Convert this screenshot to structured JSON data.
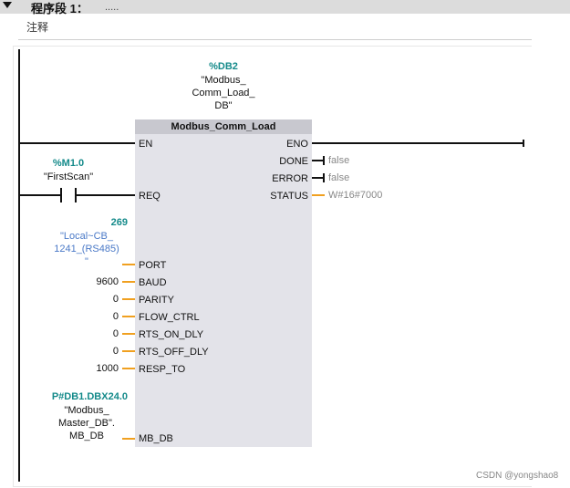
{
  "network": {
    "title": "程序段 1：",
    "description": ".....",
    "comment": "注释"
  },
  "block": {
    "instance_op": "%DB2",
    "instance_name": [
      "\"Modbus_",
      "Comm_Load_",
      "DB\""
    ],
    "title": "Modbus_Comm_Load",
    "input_pins": [
      "EN",
      "REQ",
      "PORT",
      "BAUD",
      "PARITY",
      "FLOW_CTRL",
      "RTS_ON_DLY",
      "RTS_OFF_DLY",
      "RESP_TO",
      "MB_DB"
    ],
    "output_pins": [
      "ENO",
      "DONE",
      "ERROR",
      "STATUS"
    ]
  },
  "req_contact": {
    "operand": "%M1.0",
    "symbol": "\"FirstScan\""
  },
  "port_param": {
    "value": "269",
    "symbol": [
      "\"Local~CB_",
      "1241_(RS485)",
      "\""
    ]
  },
  "params": {
    "baud": "9600",
    "parity": "0",
    "flow_ctrl": "0",
    "rts_on_dly": "0",
    "rts_off_dly": "0",
    "resp_to": "1000"
  },
  "mb_db_param": {
    "operand": "P#DB1.DBX24.0",
    "symbol": [
      "\"Modbus_",
      "Master_DB\".",
      "MB_DB"
    ]
  },
  "outputs": {
    "done": "false",
    "error": "false",
    "status": "W#16#7000"
  },
  "watermark": "CSDN @yongshao8",
  "colors": {
    "operand": "#148a8a",
    "symbol_blue": "#4a79c7",
    "wire_param": "#f0a020",
    "block_bg": "#e3e3e9"
  }
}
